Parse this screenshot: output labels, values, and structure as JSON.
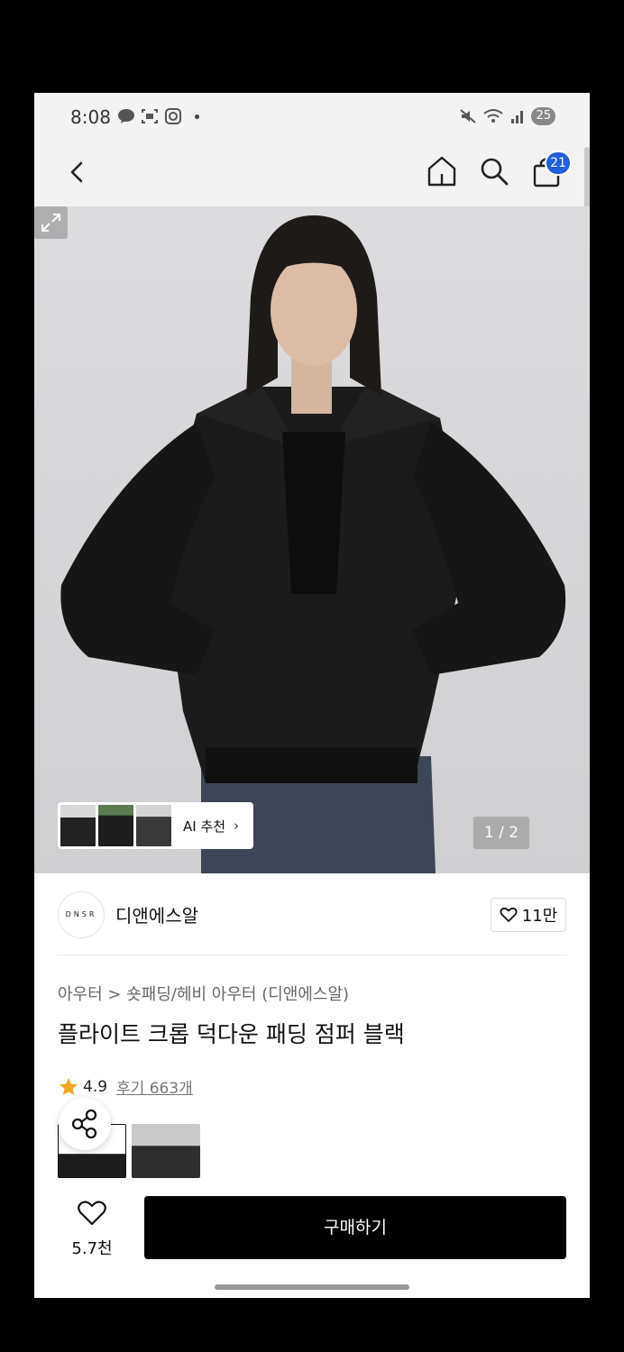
{
  "status_bar": {
    "time": "8:08",
    "battery": "25",
    "left_icons": [
      "talk-icon",
      "screenshot-icon",
      "instagram-icon",
      "dot"
    ],
    "right_icons": [
      "mute-icon",
      "wifi-icon",
      "signal-icon",
      "battery-icon"
    ]
  },
  "nav": {
    "cart_count": "21",
    "accent_color": "#1f5fe0"
  },
  "gallery": {
    "ai_label": "AI 추천",
    "page_counter": "1 / 2"
  },
  "brand": {
    "logo_text": "DNSR",
    "name": "디앤에스알",
    "likes": "11만"
  },
  "product": {
    "breadcrumb": "아우터 > 숏패딩/헤비 아우터 (디앤에스알)",
    "title": "플라이트 크롭 덕다운 패딩 점퍼 블랙",
    "rating": "4.9",
    "reviews": "후기 663개"
  },
  "bottom": {
    "wish_count": "5.7천",
    "buy_label": "구매하기"
  }
}
